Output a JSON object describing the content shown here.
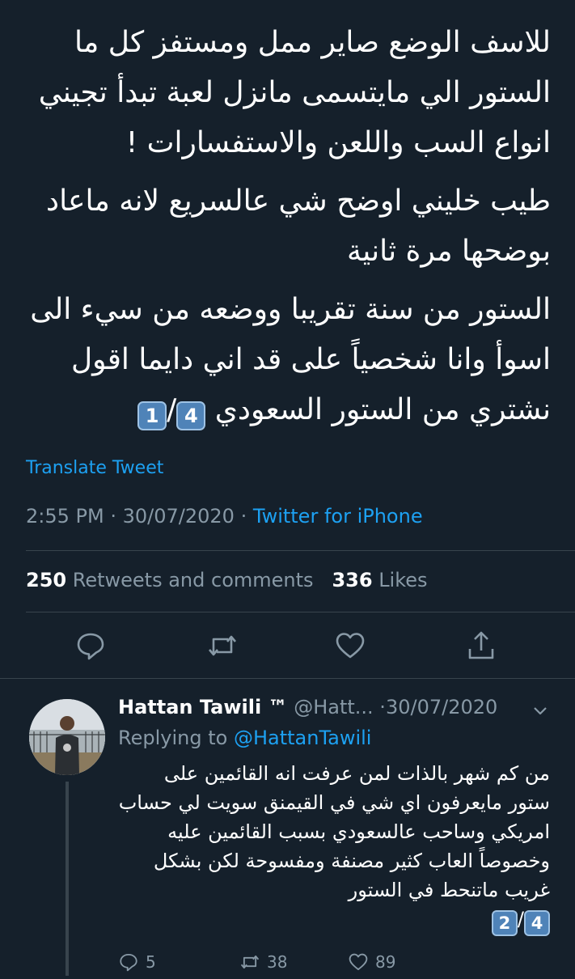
{
  "tweet": {
    "paragraphs": [
      "للاسف الوضع صاير ممل ومستفز كل ما الستور الي مايتسمى مانزل لعبة تبدأ تجيني انواع السب واللعن والاستفسارات !",
      "طيب خليني اوضح شي عالسريع لانه ماعاد بوضحها مرة ثانية",
      "الستور من سنة تقريبا ووضعه من سيء الى اسوأ وانا شخصياً على قد اني دايما اقول نشتري من الستور السعودي"
    ],
    "thread_marker": {
      "current": "1",
      "total": "4",
      "separator": "/"
    },
    "translate_label": "Translate Tweet",
    "time": "2:55 PM",
    "dot": "·",
    "date": "30/07/2020",
    "source": "Twitter for iPhone",
    "retweets_count": "250",
    "retweets_label": "Retweets and comments",
    "likes_count": "336",
    "likes_label": "Likes"
  },
  "reply": {
    "display_name": "Hattan Tawili ™",
    "handle": "@Hatt...",
    "dot": "·",
    "date": "30/07/2020",
    "replying_prefix": "Replying to",
    "replying_to": "@HattanTawili",
    "text": "من كم شهر بالذات لمن عرفت انه القائمين على ستور مايعرفون اي شي في القيمنق سويت لي حساب امريكي وساحب عالسعودي بسبب القائمين عليه وخصوصاً العاب كثير مصنفة ومفسوحة لكن بشكل غريب ماتنحط في الستور",
    "thread_marker": {
      "current": "2",
      "total": "4",
      "separator": "/"
    },
    "reply_count": "5",
    "retweet_count": "38",
    "like_count": "89"
  },
  "icons": {
    "reply": "reply-icon",
    "retweet": "retweet-icon",
    "like": "heart-icon",
    "share": "share-icon",
    "chevron": "chevron-down-icon"
  },
  "colors": {
    "background": "#15202b",
    "text": "#ffffff",
    "muted": "#8899a6",
    "accent": "#1da1f2",
    "divider": "#38444d"
  }
}
